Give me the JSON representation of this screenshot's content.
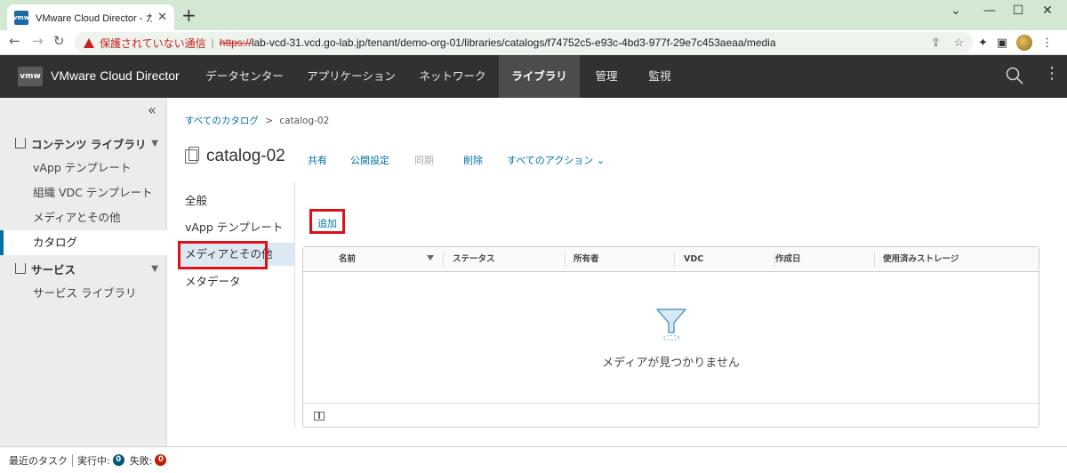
{
  "browser": {
    "tab_title": "VMware Cloud Director - カタログ",
    "tab_favicon": "vmw",
    "warning_text": "保護されていない通信",
    "url_scheme": "https://",
    "url_rest": "lab-vcd-31.vcd.go-lab.jp/tenant/demo-org-01/libraries/catalogs/f74752c5-e93c-4bd3-977f-29e7c453aeaa/media"
  },
  "header": {
    "logo": "vmw",
    "brand": "VMware Cloud Director",
    "nav": [
      "データセンター",
      "アプリケーション",
      "ネットワーク",
      "ライブラリ",
      "管理",
      "監視"
    ],
    "active_nav": "ライブラリ"
  },
  "sidebar": {
    "section_content": "コンテンツ ライブラリ",
    "items": [
      "vApp テンプレート",
      "組織 VDC テンプレート",
      "メディアとその他",
      "カタログ"
    ],
    "active_item": "カタログ",
    "section_services": "サービス",
    "service_items": [
      "サービス ライブラリ"
    ]
  },
  "breadcrumb": {
    "root": "すべてのカタログ",
    "separator": ">",
    "current": "catalog-02"
  },
  "page": {
    "title": "catalog-02",
    "actions": {
      "share": "共有",
      "publish": "公開設定",
      "sync": "同期",
      "delete": "削除",
      "all_actions": "すべてのアクション ⌄"
    }
  },
  "subnav": {
    "general": "全般",
    "vapp_templates": "vApp テンプレート",
    "media": "メディアとその他",
    "metadata": "メタデータ",
    "active": "メディアとその他"
  },
  "grid": {
    "add_label": "追加",
    "columns": [
      "名前",
      "ステータス",
      "所有者",
      "VDC",
      "作成日",
      "使用済みストレージ"
    ],
    "empty_text": "メディアが見つかりません"
  },
  "taskbar": {
    "recent_tasks": "最近のタスク",
    "running_label": "実行中:",
    "running_count": "0",
    "failed_label": "失敗:",
    "failed_count": "0"
  },
  "colors": {
    "accent": "#0072a3",
    "header_bg": "#313131",
    "highlight_box": "#e01018",
    "failed_badge": "#c21d00",
    "running_badge": "#00567a"
  }
}
